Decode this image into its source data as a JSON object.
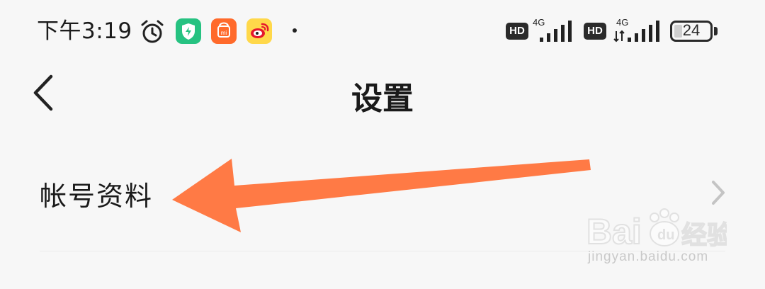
{
  "status_bar": {
    "time": "下午3:19",
    "icons": [
      "alarm-icon",
      "security-app-icon",
      "mi-store-app-icon",
      "weibo-app-icon"
    ],
    "hd_label": "HD",
    "network_labels": [
      "4G",
      "4G"
    ],
    "battery_level": "24"
  },
  "header": {
    "back_icon": "chevron-left-icon",
    "title": "设置"
  },
  "settings": {
    "items": [
      {
        "label": "帐号资料",
        "icon": "chevron-right-icon"
      }
    ]
  },
  "annotation": {
    "arrow_color": "#ff7a45"
  },
  "watermark": {
    "brand": "Bai 经验",
    "url": "jingyan.baidu.com"
  }
}
